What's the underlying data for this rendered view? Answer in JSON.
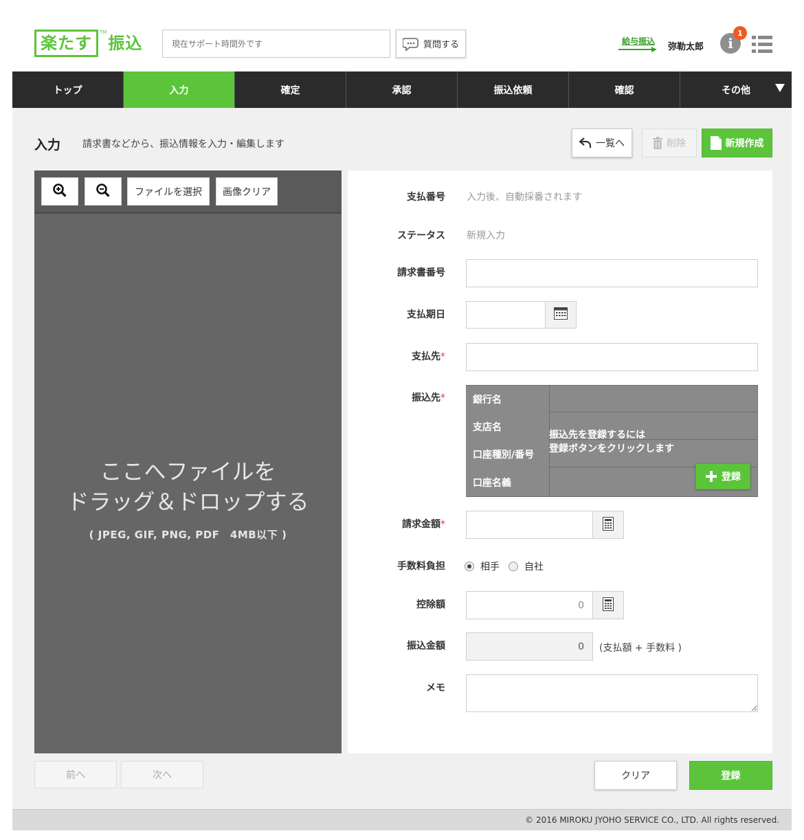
{
  "header": {
    "logo_main": "楽たす",
    "logo_tm": "TM",
    "logo_sub": "振込",
    "support_placeholder": "現在サポート時間外です",
    "ask_label": "質問する",
    "salary_link": "給与振込",
    "user_name": "弥勒太郎",
    "notification_count": "1"
  },
  "nav": {
    "tabs": [
      {
        "label": "トップ",
        "active": false
      },
      {
        "label": "入力",
        "active": true
      },
      {
        "label": "確定",
        "active": false
      },
      {
        "label": "承認",
        "active": false
      },
      {
        "label": "振込依頼",
        "active": false
      },
      {
        "label": "確認",
        "active": false
      },
      {
        "label": "その他",
        "active": false
      }
    ]
  },
  "page": {
    "title": "入力",
    "description": "請求書などから、振込情報を入力・編集します",
    "back_label": "一覧へ",
    "delete_label": "削除",
    "new_label": "新規作成"
  },
  "viewer": {
    "file_select_label": "ファイルを選択",
    "image_clear_label": "画像クリア",
    "drop_line1": "ここへファイルを",
    "drop_line2": "ドラッグ＆ドロップする",
    "drop_note": "( JPEG, GIF, PNG, PDF　4MB以下 )"
  },
  "form": {
    "payment_no_label": "支払番号",
    "payment_no_value": "入力後、自動採番されます",
    "status_label": "ステータス",
    "status_value": "新規入力",
    "invoice_no_label": "請求書番号",
    "invoice_no_value": "",
    "due_date_label": "支払期日",
    "due_date_value": "",
    "payee_label": "支払先",
    "payee_value": "",
    "transfer_to_label": "振込先",
    "bank": {
      "bank_name_label": "銀行名",
      "branch_label": "支店名",
      "account_label": "口座種別/番号",
      "holder_label": "口座名義",
      "message_line1": "振込先を登録するには",
      "message_line2": "登録ボタンをクリックします",
      "register_label": "登録"
    },
    "amount_label": "請求金額",
    "amount_value": "",
    "fee_label": "手数料負担",
    "fee_options": [
      "相手",
      "自社"
    ],
    "fee_selected": "相手",
    "deduction_label": "控除額",
    "deduction_value": "0",
    "transfer_amount_label": "振込金額",
    "transfer_amount_value": "0",
    "transfer_amount_note": "(支払額 + 手数料 )",
    "memo_label": "メモ",
    "memo_value": "",
    "required_mark": "*"
  },
  "footer_buttons": {
    "prev_label": "前へ",
    "next_label": "次へ",
    "clear_label": "クリア",
    "save_label": "登録"
  },
  "footer": {
    "copyright": "© 2016 MIROKU JYOHO SERVICE CO., LTD. All rights reserved."
  },
  "colors": {
    "accent_green": "#5cc43b",
    "nav_dark": "#2b2b2b",
    "viewer_gray": "#666666",
    "required_red": "#e8364a",
    "badge_orange": "#f05a1e"
  },
  "icons": [
    "chat-bubble-icon",
    "info-icon",
    "list-menu-icon",
    "caret-down-icon",
    "back-arrow-icon",
    "trash-icon",
    "document-icon",
    "zoom-in-icon",
    "zoom-out-icon",
    "calendar-icon",
    "calculator-icon",
    "plus-icon"
  ]
}
